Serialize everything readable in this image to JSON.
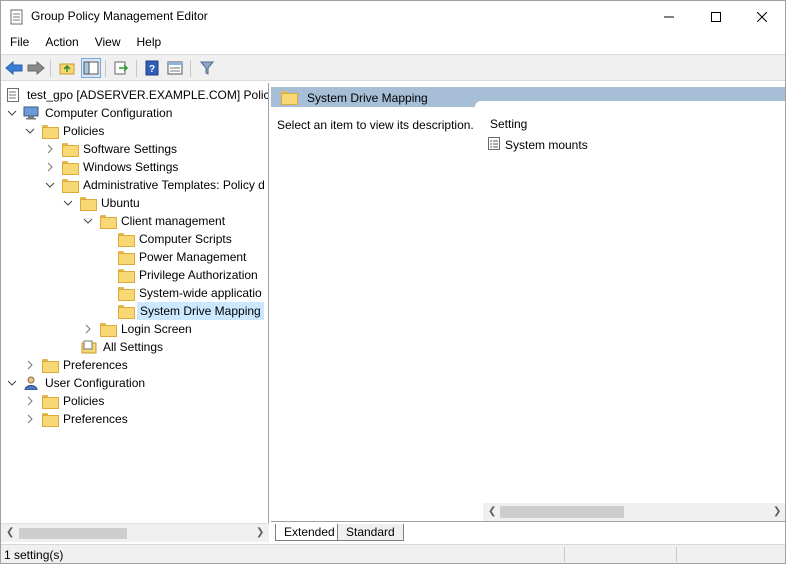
{
  "window": {
    "title": "Group Policy Management Editor"
  },
  "titlebar_buttons": {
    "minimize": "—",
    "maximize": "☐",
    "close": "✕"
  },
  "menu": [
    "File",
    "Action",
    "View",
    "Help"
  ],
  "toolbar": {
    "icons": [
      "back-icon",
      "forward-icon",
      "up-folder-icon",
      "show-hide-tree-icon",
      "export-list-icon",
      "help-icon",
      "properties-view-icon",
      "filter-icon"
    ]
  },
  "tree": {
    "nodes": [
      {
        "label": "test_gpo [ADSERVER.EXAMPLE.COM] Policy",
        "icon": "policy-icon",
        "chevron": ""
      },
      {
        "label": "Computer Configuration",
        "icon": "computer-icon",
        "chevron": "expanded"
      },
      {
        "label": "Policies",
        "icon": "folder-icon",
        "chevron": "expanded"
      },
      {
        "label": "Software Settings",
        "icon": "folder-icon",
        "chevron": "collapsed"
      },
      {
        "label": "Windows Settings",
        "icon": "folder-icon",
        "chevron": "collapsed"
      },
      {
        "label": "Administrative Templates: Policy d",
        "icon": "folder-icon",
        "chevron": "expanded"
      },
      {
        "label": "Ubuntu",
        "icon": "folder-icon",
        "chevron": "expanded"
      },
      {
        "label": "Client management",
        "icon": "folder-icon",
        "chevron": "expanded"
      },
      {
        "label": "Computer Scripts",
        "icon": "folder-icon",
        "chevron": ""
      },
      {
        "label": "Power Management",
        "icon": "folder-icon",
        "chevron": ""
      },
      {
        "label": "Privilege Authorization",
        "icon": "folder-icon",
        "chevron": ""
      },
      {
        "label": "System-wide applicatio",
        "icon": "folder-icon",
        "chevron": ""
      },
      {
        "label": "System Drive Mapping",
        "icon": "folder-icon",
        "chevron": "",
        "selected": true
      },
      {
        "label": "Login Screen",
        "icon": "folder-icon",
        "chevron": "collapsed"
      },
      {
        "label": "All Settings",
        "icon": "all-settings-icon",
        "chevron": ""
      },
      {
        "label": "Preferences",
        "icon": "folder-icon",
        "chevron": "collapsed"
      },
      {
        "label": "User Configuration",
        "icon": "user-icon",
        "chevron": "expanded"
      },
      {
        "label": "Policies",
        "icon": "folder-icon",
        "chevron": "collapsed"
      },
      {
        "label": "Preferences",
        "icon": "folder-icon",
        "chevron": "collapsed"
      }
    ]
  },
  "right_pane": {
    "header_title": "System Drive Mapping",
    "description": "Select an item to view its description.",
    "column_header": "Setting",
    "settings": [
      {
        "label": "System mounts",
        "icon": "setting-icon"
      }
    ]
  },
  "tabs": [
    "Extended",
    "Standard"
  ],
  "status": {
    "text": "1 setting(s)"
  }
}
